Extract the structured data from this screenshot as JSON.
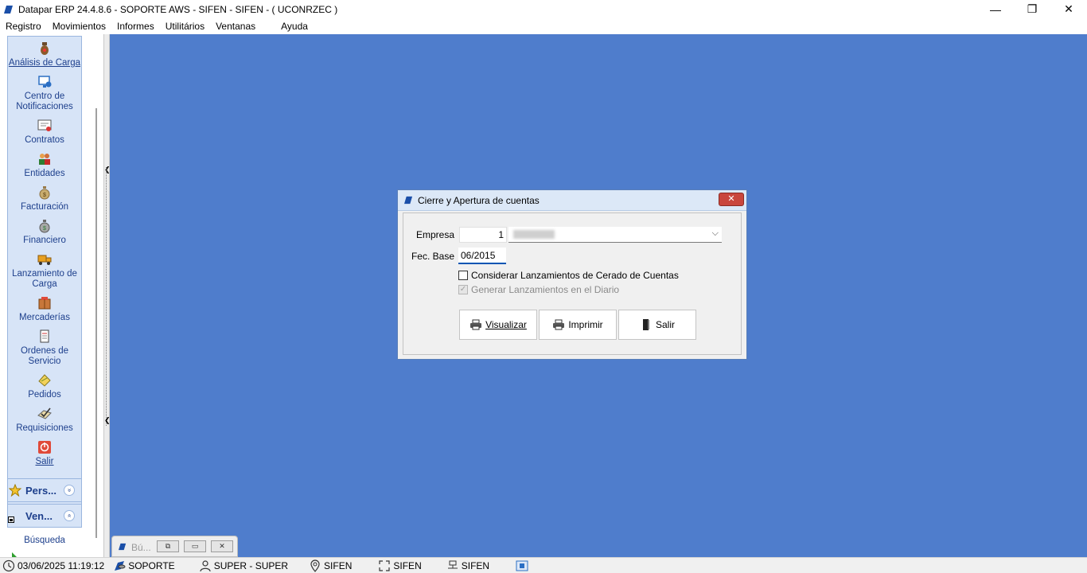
{
  "window": {
    "title": "Datapar ERP 24.4.8.6 - SOPORTE AWS - SIFEN - SIFEN -  ( UCONRZEC )",
    "minimize": "—",
    "restore": "❐",
    "close": "✕"
  },
  "menu": {
    "registro": "Registro",
    "movimientos": "Movimientos",
    "informes": "Informes",
    "utilitarios": "Utilitários",
    "ventanas": "Ventanas",
    "ayuda": "Ayuda"
  },
  "sidebar": {
    "items": [
      {
        "label": "Análisis de Carga"
      },
      {
        "label": "Centro de Notificaciones"
      },
      {
        "label": "Contratos"
      },
      {
        "label": "Entidades"
      },
      {
        "label": "Facturación"
      },
      {
        "label": "Financiero"
      },
      {
        "label": "Lanzamiento de Carga"
      },
      {
        "label": "Mercaderías"
      },
      {
        "label": "Ordenes de Servicio"
      },
      {
        "label": "Pedidos"
      },
      {
        "label": "Requisiciones"
      },
      {
        "label": "Salir"
      }
    ],
    "section_personal": "Pers...",
    "section_ventanas": "Ven...",
    "busqueda": "Búsqueda",
    "chev_down": "»",
    "chev_up": "«"
  },
  "dialog": {
    "title": "Cierre y Apertura de cuentas",
    "close": "✕",
    "empresa_label": "Empresa",
    "empresa_code": "1",
    "fec_base_label": "Fec. Base",
    "fec_base_value": "06/2015",
    "chk_considerar": "Considerar Lanzamientos de Cerado de Cuentas",
    "chk_generar": "Generar Lanzamientos en el Diario",
    "btn_visualizar": "Visualizar",
    "btn_imprimir": "Imprimir",
    "btn_salir": "Salir",
    "check_mark": "✓",
    "combo_arrow": "⌵"
  },
  "minimized_window": {
    "title": "Bú...",
    "btn_restore": "⧉",
    "btn_maximize": "▭",
    "btn_close": "✕"
  },
  "statusbar": {
    "datetime": "03/06/2025 11:19:12",
    "server": "SOPORTE",
    "user": "SUPER - SUPER",
    "db1": "SIFEN",
    "db2": "SIFEN",
    "db3": "SIFEN"
  },
  "colors": {
    "workspace": "#4f7dcc",
    "nav_text": "#1d3f8c",
    "nav_bg": "#d7e4f7"
  }
}
